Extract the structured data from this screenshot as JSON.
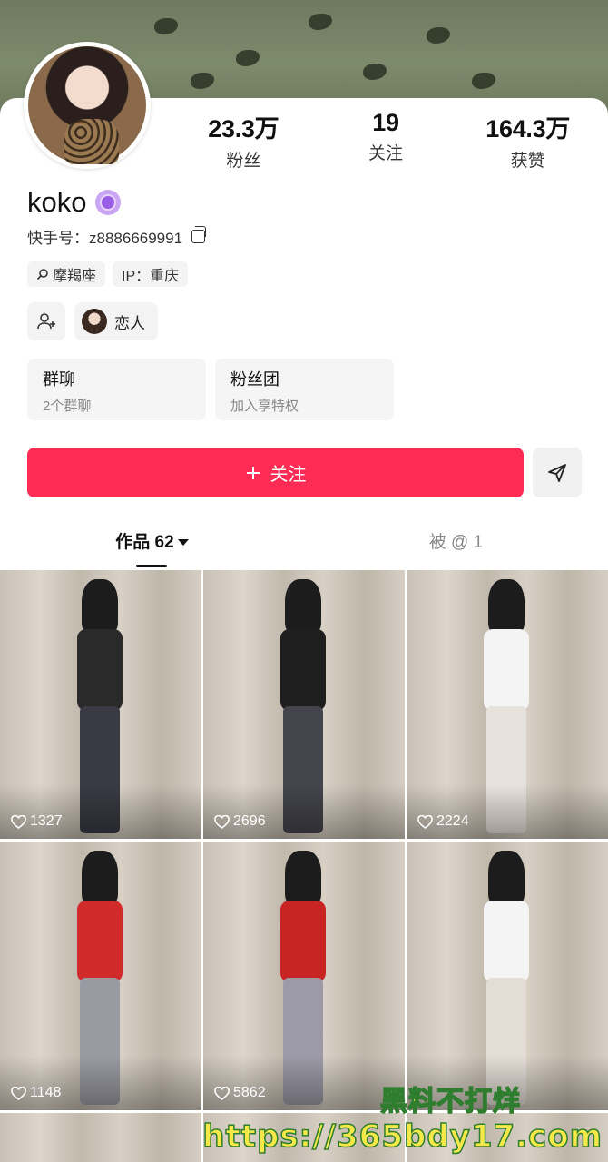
{
  "profile": {
    "name": "koko",
    "kuaishou_id": "快手号：z8886669991",
    "stats": [
      {
        "value": "23.3万",
        "label": "粉丝"
      },
      {
        "value": "19",
        "label": "关注"
      },
      {
        "value": "164.3万",
        "label": "获赞"
      }
    ],
    "tags": [
      "摩羯座",
      "IP：重庆"
    ],
    "relation_label": "恋人",
    "cards": [
      {
        "title": "群聊",
        "subtitle": "2个群聊"
      },
      {
        "title": "粉丝团",
        "subtitle": "加入享特权"
      }
    ],
    "follow_label": "关注"
  },
  "tabs": {
    "works": "作品 62",
    "mentions": "被 @ 1"
  },
  "grid": [
    {
      "likes": "1327",
      "top": "#2a2a2a",
      "legs": "#3a3a44"
    },
    {
      "likes": "2696",
      "top": "#1e1e1e",
      "legs": "#44444c"
    },
    {
      "likes": "2224",
      "top": "#f4f4f4",
      "legs": "#e8e2dc"
    },
    {
      "likes": "1148",
      "top": "#d12a2a",
      "legs": "#9a9aa2"
    },
    {
      "likes": "5862",
      "top": "#c92424",
      "legs": "#9b9aa6"
    },
    {
      "likes": "",
      "top": "#f4f4f4",
      "legs": "#e4ddd6"
    }
  ],
  "watermark": {
    "line1": "黑料不打烊",
    "line2": "https://365bdy17.com"
  },
  "colors": {
    "accent": "#fe2c55",
    "watermark_text": "#f5e94a",
    "watermark_stroke": "#2f7d2f"
  }
}
